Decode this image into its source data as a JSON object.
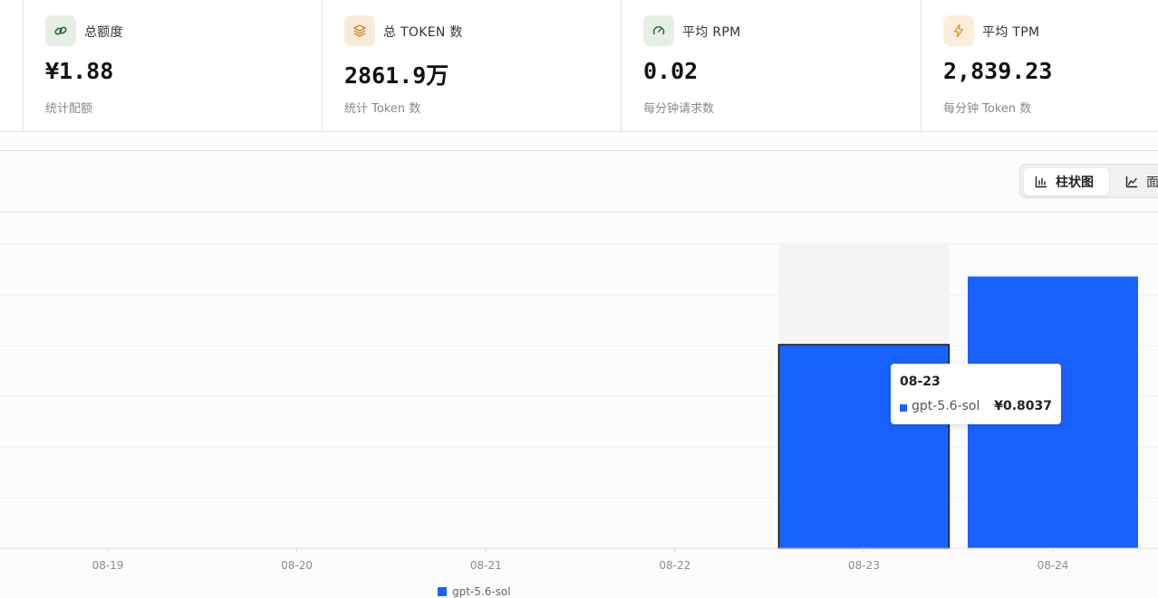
{
  "stats": [
    {
      "label": "总额度",
      "value": "¥1.88",
      "sub": "统计配额",
      "icon": "link-icon",
      "icon_bg": "#e6efe6",
      "icon_color": "#2b6b36"
    },
    {
      "label": "总 TOKEN 数",
      "value": "2861.9万",
      "sub": "统计 Token 数",
      "icon": "layers-icon",
      "icon_bg": "#f8ecd9",
      "icon_color": "#c98a2b"
    },
    {
      "label": "平均 RPM",
      "value": "0.02",
      "sub": "每分钟请求数",
      "icon": "gauge-icon",
      "icon_bg": "#e6efe6",
      "icon_color": "#2b6b36"
    },
    {
      "label": "平均 TPM",
      "value": "2,839.23",
      "sub": "每分钟 Token 数",
      "icon": "bolt-icon",
      "icon_bg": "#fbefd9",
      "icon_color": "#d9962b"
    }
  ],
  "toolbar": {
    "bar_label": "柱状图",
    "area_label": "面"
  },
  "chart_data": {
    "type": "bar",
    "categories": [
      "08-19",
      "08-20",
      "08-21",
      "08-22",
      "08-23",
      "08-24"
    ],
    "series": [
      {
        "name": "gpt-5.6-sol",
        "values": [
          0,
          0,
          0,
          0,
          0.8037,
          1.073
        ]
      }
    ],
    "ylim": [
      0,
      1.2
    ],
    "grid": true,
    "highlight_index": 4,
    "bar_color": "#1a62ff"
  },
  "tooltip": {
    "title": "08-23",
    "series_name": "gpt-5.6-sol",
    "value": "¥0.8037"
  },
  "legend": {
    "label": "gpt-5.6-sol"
  }
}
